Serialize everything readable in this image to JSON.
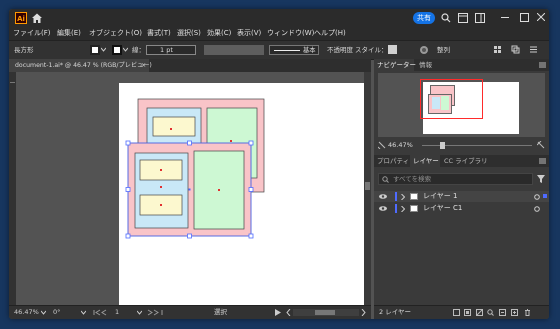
{
  "titlebar": {
    "app_logo": "Ai",
    "share_label": "共有"
  },
  "menu": [
    "ファイル(F)",
    "編集(E)",
    "オブジェクト(O)",
    "書式(T)",
    "選択(S)",
    "効果(C)",
    "表示(V)",
    "ウィンドウ(W)",
    "ヘルプ(H)"
  ],
  "control": {
    "object_type": "長方形",
    "stroke_label": "線：",
    "stroke_weight": "1 pt",
    "brush_label": "基本",
    "opacity_label": "不透明度",
    "style_label": "スタイル：",
    "align_label": "整列"
  },
  "document": {
    "tab_title": "document-1.ai* @ 46.47 % (RGB/プレビュー)",
    "close": "×"
  },
  "status": {
    "zoom": "46.47%",
    "rotation": "0°",
    "artboard_index": "1",
    "tool_label": "選択"
  },
  "panels": {
    "top_tabs": [
      "ナビゲーター",
      "情報"
    ],
    "nav_zoom": "46.47%",
    "mid_tabs": [
      "プロパティ",
      "レイヤー",
      "CC ライブラリ"
    ],
    "search_placeholder": "すべてを検索",
    "layers": [
      {
        "name": "レイヤー 1",
        "selected": true
      },
      {
        "name": "レイヤー C1",
        "selected": false
      }
    ],
    "layer_count": "2 レイヤー"
  },
  "colors": {
    "accent": "#1473e6",
    "app_bg": "#535353",
    "pink": "#f9c4c8",
    "light_blue": "#c9e8f7",
    "light_green": "#cdf8d3",
    "light_yellow": "#fcf8cf",
    "selection": "#4f6bff"
  }
}
